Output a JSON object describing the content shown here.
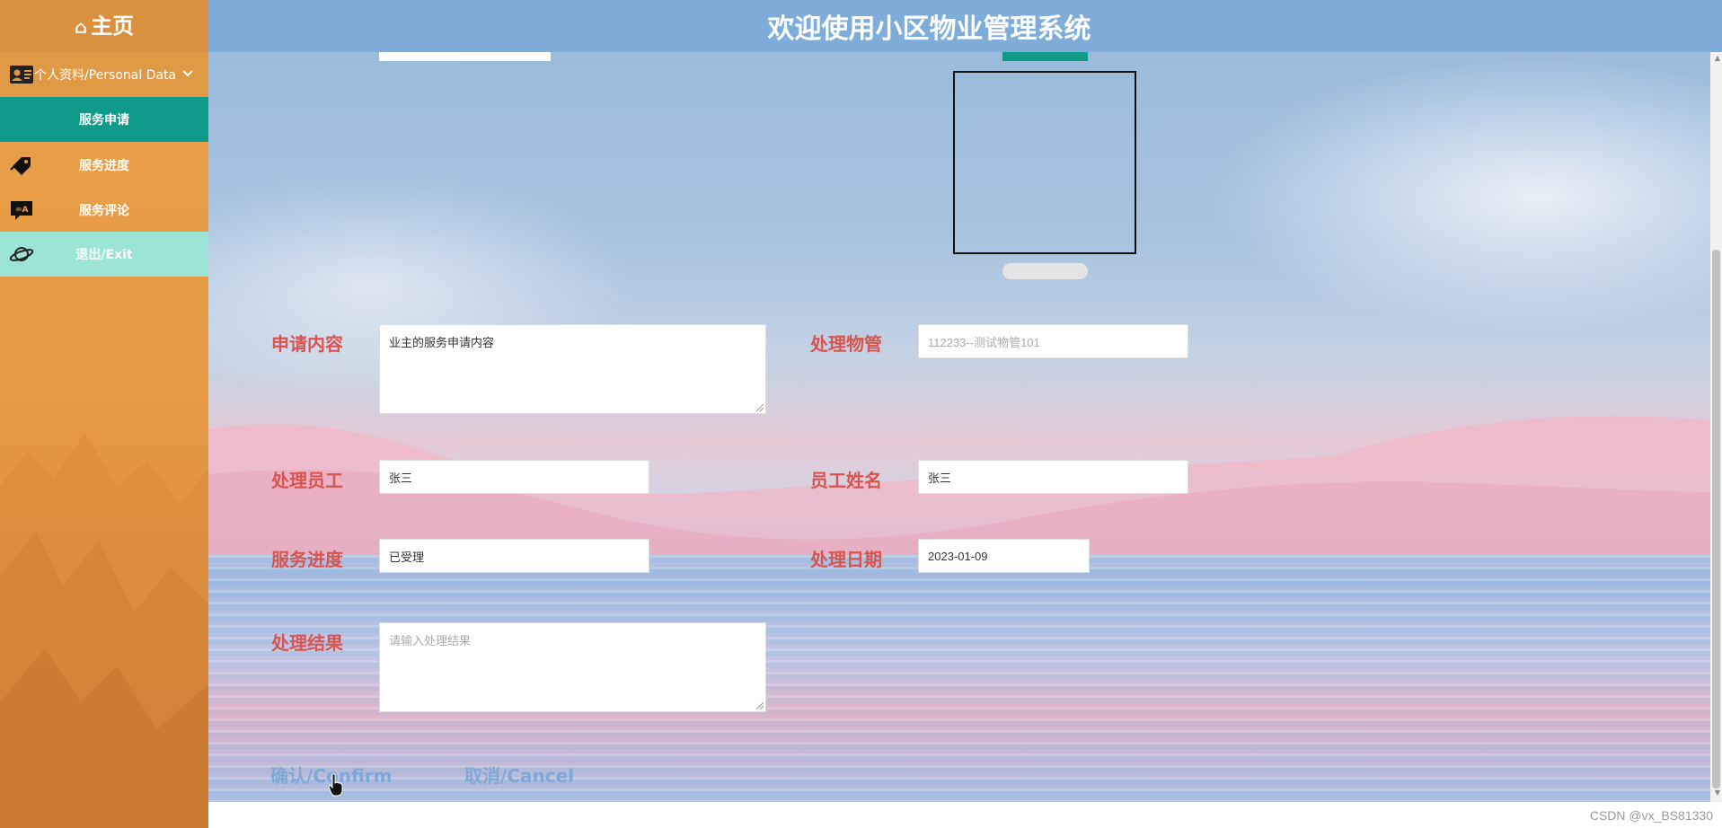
{
  "sidebar": {
    "home_label": "主页",
    "personal_label": "个人资料/Personal Data",
    "items": [
      {
        "label": "服务申请",
        "active": true
      },
      {
        "label": "服务进度",
        "icon": "tag-icon"
      },
      {
        "label": "服务评论",
        "icon": "comment-icon"
      }
    ],
    "exit_label": "退出/Exit"
  },
  "header": {
    "title": "欢迎使用小区物业管理系统"
  },
  "form": {
    "content_label": "申请内容",
    "content_value": "业主的服务申请内容",
    "manager_label": "处理物管",
    "manager_value": "112233--测试物管101",
    "staff_label": "处理员工",
    "staff_value": "张三",
    "staff_name_label": "员工姓名",
    "staff_name_value": "张三",
    "progress_label": "服务进度",
    "progress_value": "已受理",
    "date_label": "处理日期",
    "date_value": "2023-01-09",
    "result_label": "处理结果",
    "result_placeholder": "请输入处理结果"
  },
  "buttons": {
    "confirm": "确认/Confirm",
    "cancel": "取消/Cancel"
  },
  "footer": {
    "watermark": "CSDN @vx_BS81330"
  },
  "colors": {
    "sidebar": "#e79b45",
    "active": "#0e9b8a",
    "exit": "#9be4d6",
    "header": "#7fadd9",
    "label": "#d9534f",
    "button_text": "#7fa8d6"
  }
}
